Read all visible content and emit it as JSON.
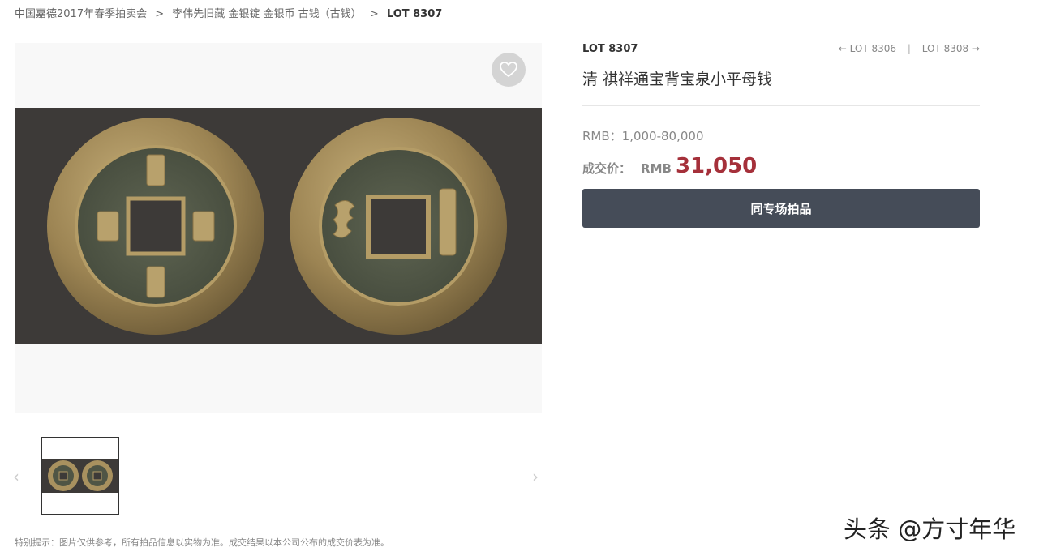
{
  "breadcrumb": {
    "items": [
      "中国嘉德2017年春季拍卖会",
      "李伟先旧藏 金银锭 金银币 古钱（古钱）"
    ],
    "separator": ">",
    "current": "LOT 8307"
  },
  "gallery": {
    "prev_arrow": "‹",
    "next_arrow": "›"
  },
  "lot": {
    "label": "LOT 8307",
    "prev": "← LOT 8306",
    "divider": "|",
    "next": "LOT 8308 →",
    "title": "清 祺祥通宝背宝泉小平母钱",
    "estimate": "RMB：1,000-80,000",
    "price_label": "成交价：",
    "price_currency": "RMB",
    "price_value": "31,050",
    "same_session_button": "同专场拍品"
  },
  "disclaimer": "特别提示：图片仅供参考，所有拍品信息以实物为准。成交结果以本公司公布的成交价表为准。",
  "watermark": "头条 @方寸年华",
  "colors": {
    "accent_price": "#a5303a",
    "button_bg": "#454c58",
    "photo_bg": "#3d3a38",
    "coin_bronze": "#a8915f"
  },
  "icons": [
    "heart-icon",
    "chevron-left-icon",
    "chevron-right-icon"
  ]
}
